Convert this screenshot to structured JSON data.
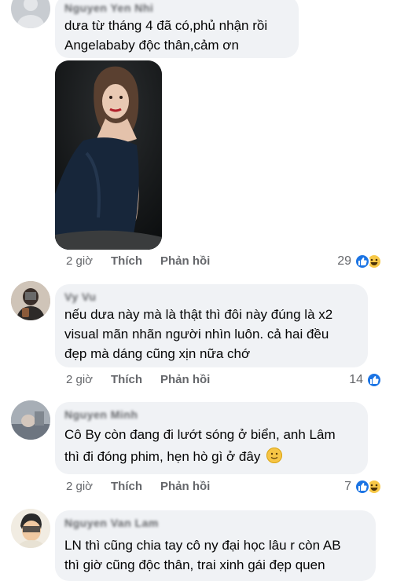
{
  "comments": [
    {
      "name": "Nguyen Yen Nhi",
      "lines": [
        "dưa từ tháng 4 đã có,phủ nhận rồi",
        "Angelababy độc thân,cảm ơn"
      ],
      "time": "2 giờ",
      "like": "Thích",
      "reply": "Phản hồi",
      "reaction_count": "29",
      "reactions": [
        "like-icon",
        "haha-icon"
      ],
      "photo": "woman-in-dark-velvet-dress"
    },
    {
      "name": "Vy Vu",
      "lines": [
        "nếu dưa này mà là thật thì đôi này đúng là x2",
        "visual mãn nhãn người nhìn luôn. cả hai đều",
        "đẹp mà dáng cũng xịn nữa chớ"
      ],
      "time": "2 giờ",
      "like": "Thích",
      "reply": "Phản hồi",
      "reaction_count": "14",
      "reactions": [
        "like-icon"
      ]
    },
    {
      "name": "Nguyen Minh",
      "lines": [
        "Cô By còn đang đi lướt sóng ở biển, anh Lâm",
        "thì đi đóng phim, hẹn hò gì ở đây"
      ],
      "time": "2 giờ",
      "like": "Thích",
      "reply": "Phản hồi",
      "reaction_count": "7",
      "reactions": [
        "like-icon",
        "haha-icon"
      ],
      "inline_emoji": "slightly-smiling-face-emoji"
    },
    {
      "name": "Nguyen Van Lam",
      "lines": [
        "LN thì cũng chia tay cô ny đại học lâu r còn AB",
        "thì giờ cũng độc thân, trai xinh gái đẹp quen"
      ]
    }
  ],
  "colors": {
    "bubble": "#f0f2f5",
    "like_blue": "#1b74e4",
    "meta_gray": "#65676b",
    "haha_yellow": "#f7c847"
  }
}
